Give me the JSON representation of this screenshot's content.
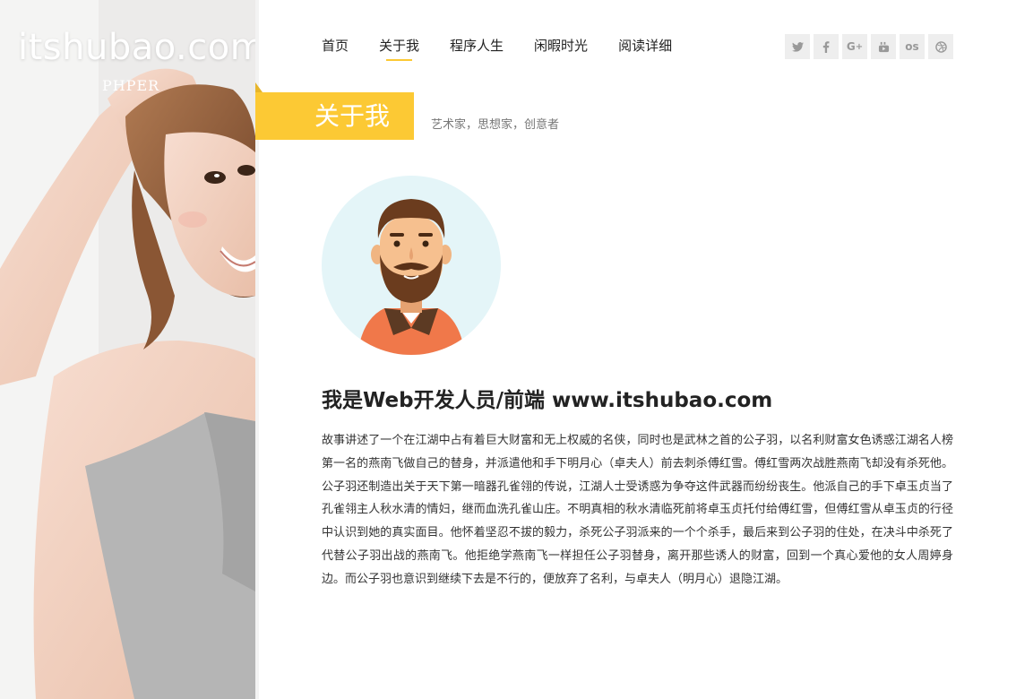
{
  "brand": {
    "title": "itshubao.com",
    "subtitle": "PHPER"
  },
  "nav": {
    "items": [
      {
        "label": "首页"
      },
      {
        "label": "关于我"
      },
      {
        "label": "程序人生"
      },
      {
        "label": "闲暇时光"
      },
      {
        "label": "阅读详细"
      }
    ],
    "active_index": 1
  },
  "social": [
    {
      "icon": "twitter-icon",
      "glyph": "🐦"
    },
    {
      "icon": "facebook-icon",
      "glyph": "f"
    },
    {
      "icon": "google-plus-icon",
      "glyph": "G+"
    },
    {
      "icon": "youtube-icon",
      "glyph": "▶"
    },
    {
      "icon": "lastfm-icon",
      "glyph": "os"
    },
    {
      "icon": "dribbble-icon",
      "glyph": "◎"
    }
  ],
  "section": {
    "title": "关于我",
    "tagline": "艺术家，思想家，创意者"
  },
  "colors": {
    "accent": "#fcc934",
    "avatar_bg": "#e4f5f8",
    "shirt": "#f0784a",
    "hair": "#6b3c1e"
  },
  "content": {
    "heading": "我是Web开发人员/前端 www.itshubao.com",
    "paragraph": "故事讲述了一个在江湖中占有着巨大财富和无上权威的名侠，同时也是武林之首的公子羽，以名利财富女色诱惑江湖名人榜第一名的燕南飞做自己的替身，并派遣他和手下明月心（卓夫人）前去刺杀傅红雪。傅红雪两次战胜燕南飞却没有杀死他。公子羽还制造出关于天下第一暗器孔雀翎的传说，江湖人士受诱惑为争夺这件武器而纷纷丧生。他派自己的手下卓玉贞当了孔雀翎主人秋水清的情妇，继而血洗孔雀山庄。不明真相的秋水清临死前将卓玉贞托付给傅红雪，但傅红雪从卓玉贞的行径中认识到她的真实面目。他怀着坚忍不拔的毅力，杀死公子羽派来的一个个杀手，最后来到公子羽的住处，在决斗中杀死了代替公子羽出战的燕南飞。他拒绝学燕南飞一样担任公子羽替身，离开那些诱人的财富，回到一个真心爱他的女人周婷身边。而公子羽也意识到继续下去是不行的，便放弃了名利，与卓夫人（明月心）退隐江湖。"
  }
}
